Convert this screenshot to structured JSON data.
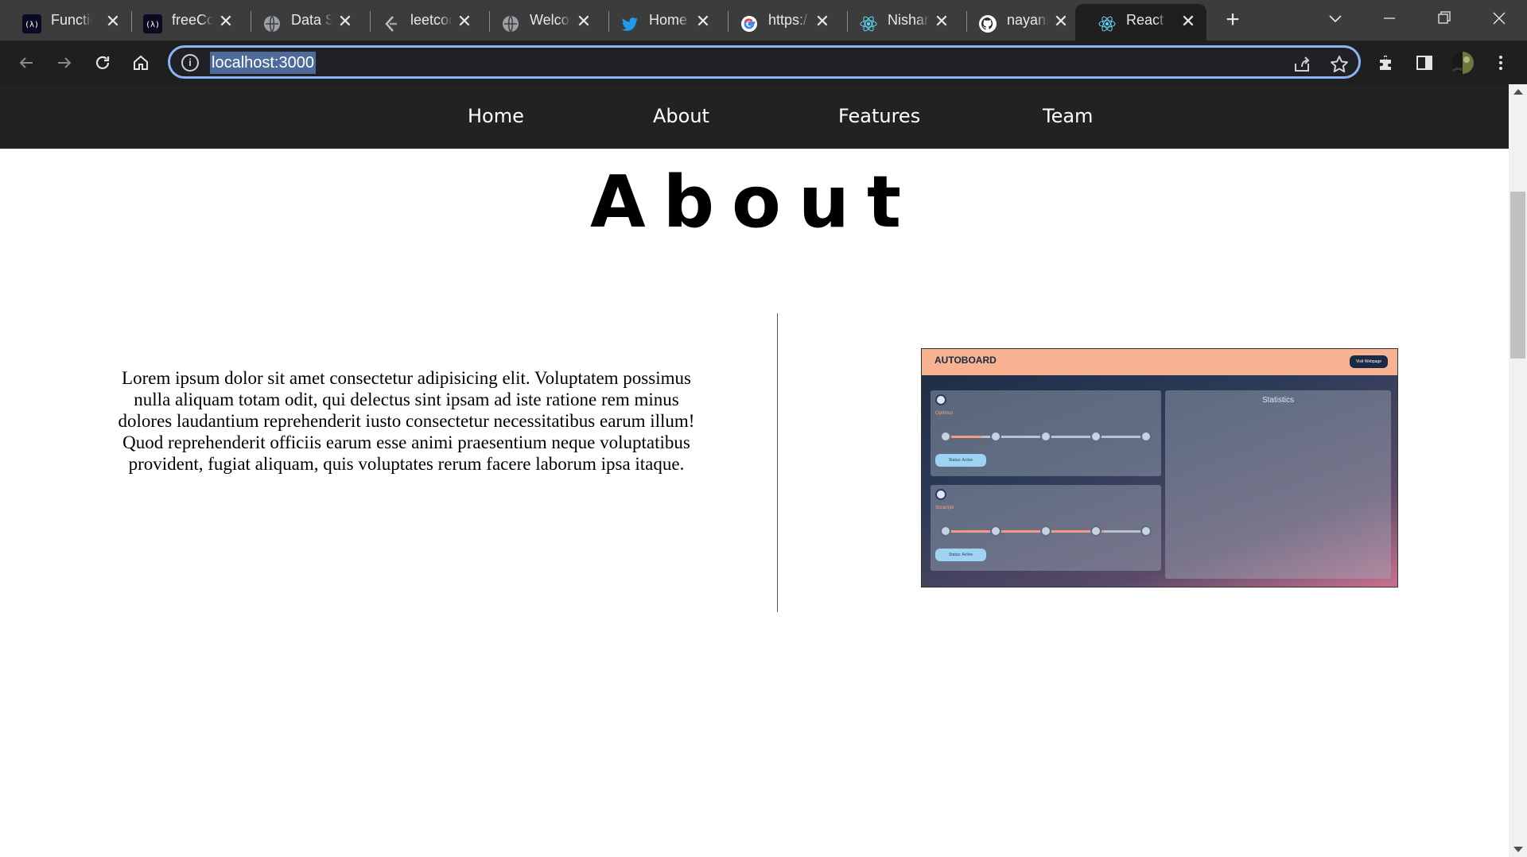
{
  "browser": {
    "tabs": [
      {
        "title": "Functio",
        "icon": "freecodecamp-icon"
      },
      {
        "title": "freeCo",
        "icon": "freecodecamp-icon"
      },
      {
        "title": "Data S",
        "icon": "globe-icon"
      },
      {
        "title": "leetcod",
        "icon": "leetcode-icon"
      },
      {
        "title": "Welcor",
        "icon": "globe-icon"
      },
      {
        "title": "Home",
        "icon": "twitter-icon"
      },
      {
        "title": "https:/",
        "icon": "google-icon"
      },
      {
        "title": "Nishan",
        "icon": "react-icon"
      },
      {
        "title": "nayani",
        "icon": "github-icon"
      },
      {
        "title": "React /",
        "icon": "react-icon",
        "active": true
      }
    ],
    "url": "localhost:3000",
    "colors": {
      "tabstrip": "#3c3c3c",
      "toolbar": "#1f1f1f",
      "focus_ring": "#8ab4f8"
    }
  },
  "site": {
    "nav": {
      "home": "Home",
      "about": "About",
      "features": "Features",
      "team": "Team"
    },
    "heading": "About",
    "body_text": "Lorem ipsum dolor sit amet consectetur adipisicing elit. Voluptatem possimus nulla aliquam totam odit, qui delectus sint ipsam ad iste ratione rem minus dolores laudantium reprehenderit iusto consectetur necessitatibus earum illum! Quod reprehenderit officiis earum esse animi praesentium neque voluptatibus provident, fugiat aliquam, quis voluptates rerum facere laborum ipsa itaque.",
    "preview": {
      "logo": "AUTOBOARD",
      "visit_button": "Visit Webpage",
      "cards": [
        {
          "name": "Optimus",
          "status": "Status: Active",
          "progress": 0.2
        },
        {
          "name": "Scramjet",
          "status": "Status: Active",
          "progress": 0.8
        }
      ],
      "stats_title": "Statistics"
    }
  }
}
